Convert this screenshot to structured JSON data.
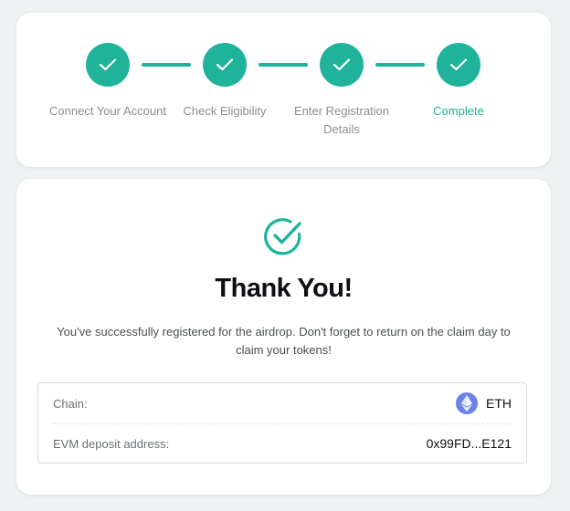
{
  "steps": [
    {
      "label": "Connect Your Account",
      "status": "done"
    },
    {
      "label": "Check Eligibility",
      "status": "done"
    },
    {
      "label": "Enter Registration Details",
      "status": "done"
    },
    {
      "label": "Complete",
      "status": "active"
    }
  ],
  "colors": {
    "accent": "#1fb39b",
    "eth": "#6b82e6"
  },
  "confirmation": {
    "icon": "check-circle-icon",
    "title": "Thank You!",
    "message": "You've successfully registered for the airdrop. Don't forget to return on the claim day to claim your tokens!"
  },
  "details": {
    "chain_label": "Chain:",
    "chain_value": "ETH",
    "chain_icon": "ethereum-icon",
    "address_label": "EVM deposit address:",
    "address_value": "0x99FD...E121"
  }
}
